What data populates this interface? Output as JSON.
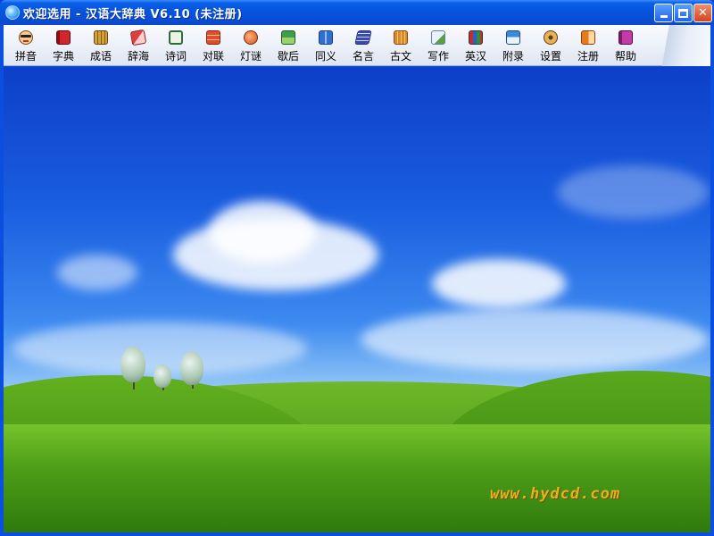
{
  "window": {
    "title": "欢迎选用 - 汉语大辞典 V6.10 (未注册)"
  },
  "toolbar": {
    "items": [
      {
        "label": "拼音",
        "icon": "pinyin-face-icon"
      },
      {
        "label": "字典",
        "icon": "dictionary-book-icon"
      },
      {
        "label": "成语",
        "icon": "idiom-books-icon"
      },
      {
        "label": "辞海",
        "icon": "cihai-book-icon"
      },
      {
        "label": "诗词",
        "icon": "poetry-scroll-icon"
      },
      {
        "label": "对联",
        "icon": "couplet-icon"
      },
      {
        "label": "灯谜",
        "icon": "lantern-riddle-icon"
      },
      {
        "label": "歇后",
        "icon": "xiehouyu-icon"
      },
      {
        "label": "同义",
        "icon": "synonym-book-icon"
      },
      {
        "label": "名言",
        "icon": "quote-icon"
      },
      {
        "label": "古文",
        "icon": "ancient-text-icon"
      },
      {
        "label": "写作",
        "icon": "writing-icon"
      },
      {
        "label": "英汉",
        "icon": "english-chinese-icon"
      },
      {
        "label": "附录",
        "icon": "appendix-icon"
      },
      {
        "label": "设置",
        "icon": "settings-icon"
      },
      {
        "label": "注册",
        "icon": "register-icon"
      },
      {
        "label": "帮助",
        "icon": "help-book-icon"
      }
    ]
  },
  "content": {
    "watermark": "www.hydcd.com"
  }
}
